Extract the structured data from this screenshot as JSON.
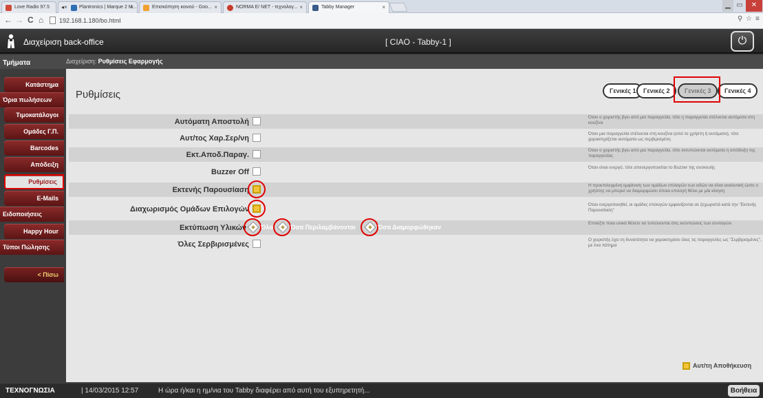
{
  "browser": {
    "tabs": [
      {
        "title": "Love Radio 97.5",
        "color": "#d04a3a"
      },
      {
        "title": "Plantronics | Marque 2 M...",
        "color": "#2d6fb4"
      },
      {
        "title": "Επισκόπηση κοινού - Goo...",
        "color": "#f0a030"
      },
      {
        "title": "NORMA E/ NET - τεχνολογ...",
        "color": "#c83a2a"
      },
      {
        "title": "Tabby Manager",
        "color": "#3a5a8a"
      }
    ],
    "url": "192.168.1.180/bo.html"
  },
  "header": {
    "app_title": "Διαχείριση back-office",
    "center_title": "[ CIAO - Tabby-1 ]",
    "power_icon": "⏻"
  },
  "subheader": {
    "section": "Τμήματα",
    "crumb_prefix": "Διαχείριση: ",
    "crumb_page": "Ρυθμίσεις Εφαρμογής"
  },
  "sidebar": {
    "items": [
      {
        "label": "Κατάστημα"
      },
      {
        "label": "Όρια πωλήσεων"
      },
      {
        "label": "Τιμοκατάλογοι"
      },
      {
        "label": "Ομάδες Γ.Π."
      },
      {
        "label": "Barcodes"
      },
      {
        "label": "Απόδειξη"
      },
      {
        "label": "Ρυθμίσεις"
      },
      {
        "label": "E-Mails"
      },
      {
        "label": "Ειδοποιήσεις"
      },
      {
        "label": "Happy Hour"
      },
      {
        "label": "Τύποι Πώλησης"
      }
    ],
    "back_label": "< Πίσω"
  },
  "main": {
    "title": "Ρυθμίσεις",
    "tabs": [
      "Γενικές 1",
      "Γενικές 2",
      "Γενικές 3",
      "Γενικές 4"
    ],
    "selected_tab": "Γενικές 3",
    "rows": [
      {
        "label": "Αυτόματη Αποστολή",
        "checked": false,
        "desc": "Όταν ο χειριστής βγει από μια παραγγελία, τότε η παραγγελία στέλνεται αυτόματα στη κουζίνα"
      },
      {
        "label": "Αυτ/τος Χαρ.Σερ/νη",
        "checked": false,
        "desc": "Όταν μια παραγγελία στέλνεται στη κουζίνα (από το χρήστη ή αυτόματα), τότε χαρακτηρίζεται αυτόματα ως σερβιρισμένη"
      },
      {
        "label": "Εκτ.Αποδ.Παραγ.",
        "checked": false,
        "desc": "Όταν ο χειριστής βγει από μια παραγγελία, τότε εκτυπώνεται αυτόματα η απόδειξη της παραγγελίας"
      },
      {
        "label": "Buzzer Off",
        "checked": false,
        "desc": "Όταν είναι ενεργό, τότε απενεργοποιείται το Buzzer της συσκευής"
      },
      {
        "label": "Εκτενής Παρουσίαση",
        "checked": true,
        "desc": "Η προεπιλεγμένη εμφάνιση των ομάδων επιλογών των ειδών να είναι αναλυτική ώστε ο χρήστης να μπορεί να διαμορφώσει όποια επιλογή θέλει με μία κίνηση"
      },
      {
        "label": "Διαχωρισμός Ομάδων Επιλογών",
        "checked": true,
        "desc": "Όταν ενεργοποιηθεί, οι ομάδες επιλογών εμφανίζονται σε ξεχωριστά κατά την \"Εκτενής Παρουσίαση\""
      },
      {
        "label": "Εκτύπωση Υλικών",
        "desc": "Επιλέξτε ποια υλικά θέλετε να τυπώνονται στις εκτυπώσεις των συνταγών"
      },
      {
        "label": "Όλες Σερβιρισμένες",
        "checked": false,
        "desc": "Ο χειριστής έχει τη δυνατότητα να χαρακτηρίσει όλες τις παραγγελίες ως \"Σερβιρισμένες\", με ένα πάτημα"
      }
    ],
    "print_options": [
      "Όλα",
      "Όσα Περιλαμβάνονται",
      "Όσα Διαμορφώθηκαν"
    ],
    "autosave_label": "Αυτ/τη Αποθήκευση"
  },
  "footer": {
    "company": "ΤΕΧΝΟΓΝΩΣΙΑ",
    "datetime": "| 14/03/2015 12:57",
    "message": "Η ώρα ή/και η ημ/νια του Tabby διαφέρει από αυτή του εξυπηρετητή...",
    "help_label": "Βοήθεια"
  },
  "colors": {
    "accent_red": "#e00000",
    "sidebar_red": "#8b2a2a",
    "checkbox_yellow": "#f2c43a"
  }
}
